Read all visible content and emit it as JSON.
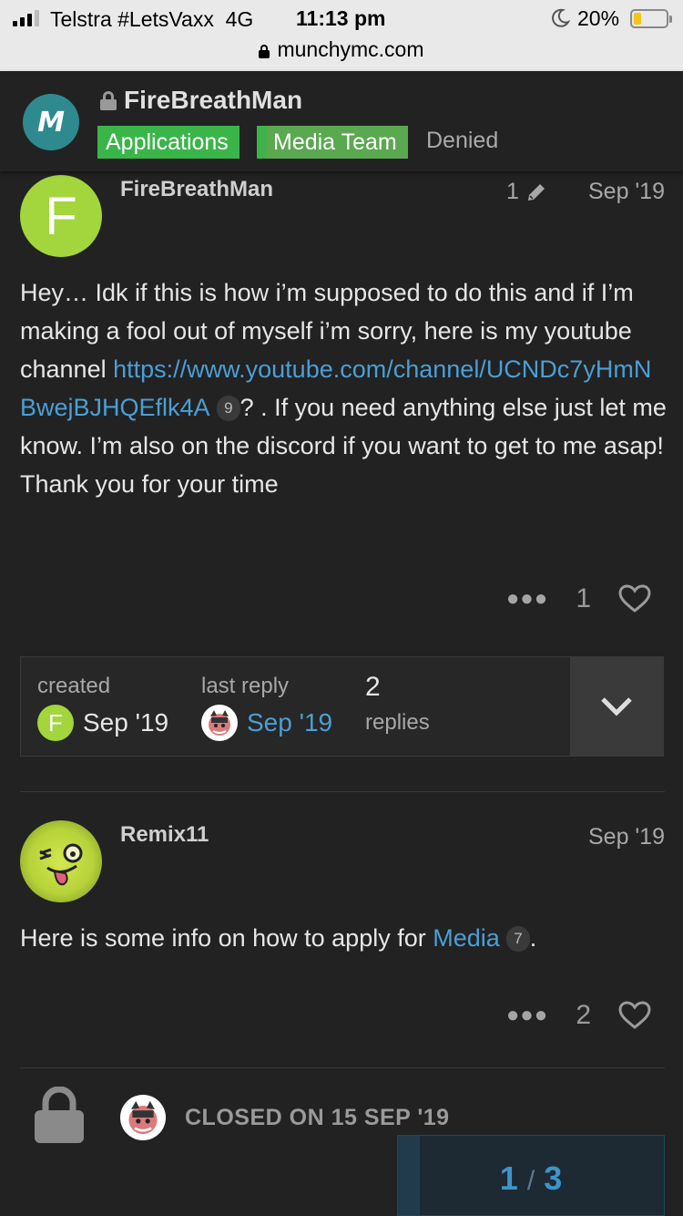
{
  "status_bar": {
    "carrier": "Telstra #LetsVaxx",
    "network": "4G",
    "time": "11:13 pm",
    "battery_percent": "20%",
    "url": "munchymc.com"
  },
  "topic": {
    "title": "FireBreathMan",
    "category": "Applications",
    "subcategory": "Media Team",
    "tag": "Denied"
  },
  "posts": [
    {
      "avatar_letter": "F",
      "username": "FireBreathMan",
      "edit_count": "1",
      "date": "Sep '19",
      "body_text_1": "Hey… Idk if this is how i’m supposed to do this and if I’m making a fool out of myself i’m sorry, here is my youtube channel ",
      "link_text": "https://www.youtube.com/channel/UCNDc7yHmNBwejBJHQEflk4A",
      "link_clicks": "9",
      "body_text_2": "? . If you need anything else just let me know. I’m also on the discord if you want to get to me asap! Thank you for your time",
      "likes": "1"
    },
    {
      "username": "Remix11",
      "date": "Sep '19",
      "body_text_1": "Here is some info on how to apply for ",
      "link_text": "Media",
      "link_clicks": "7",
      "body_text_2": ".",
      "likes": "2"
    }
  ],
  "topic_map": {
    "created_label": "created",
    "created_avatar_letter": "F",
    "created_date": "Sep '19",
    "last_reply_label": "last reply",
    "last_reply_date": "Sep '19",
    "reply_count": "2",
    "replies_label": "replies"
  },
  "closed_notice": "CLOSED ON 15 SEP '19",
  "progress": {
    "current": "1",
    "total": "3"
  },
  "colors": {
    "accent_link": "#4a9fd6",
    "category_green": "#3ab54a",
    "avatar_green": "#a2d63c"
  }
}
